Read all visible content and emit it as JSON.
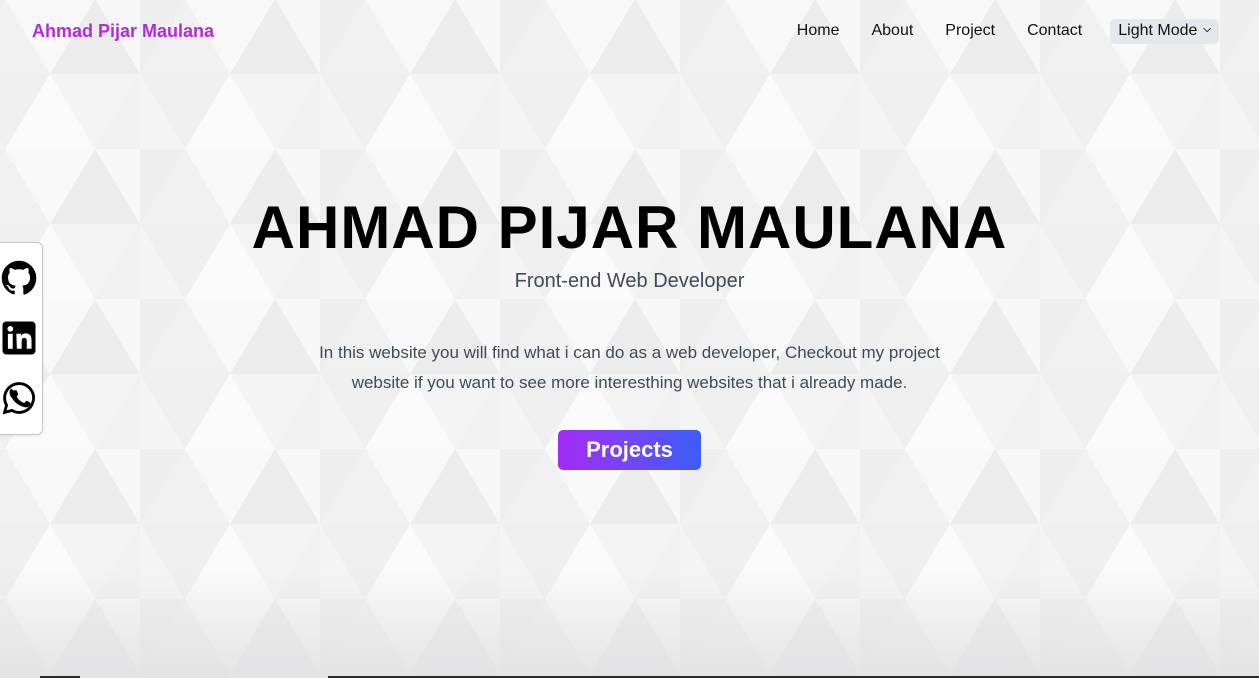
{
  "nav": {
    "brand": "Ahmad Pijar Maulana",
    "links": [
      "Home",
      "About",
      "Project",
      "Contact"
    ],
    "theme_select": {
      "selected": "Light Mode"
    }
  },
  "social": {
    "icons": [
      "github-icon",
      "linkedin-icon",
      "whatsapp-icon"
    ]
  },
  "hero": {
    "title": "AHMAD PIJAR MAULANA",
    "subtitle": "Front-end Web Developer",
    "description_line1": "In this website you will find what i can do as a web developer, Checkout my project",
    "description_line2": "website if you want to see more interesthing websites that i already made.",
    "cta_label": "Projects"
  },
  "colors": {
    "brand": "#b629d8",
    "button_gradient_start": "#a42bf5",
    "button_gradient_end": "#3b5df6",
    "text_muted": "#3f4a5a",
    "background": "#f6f6f6"
  }
}
